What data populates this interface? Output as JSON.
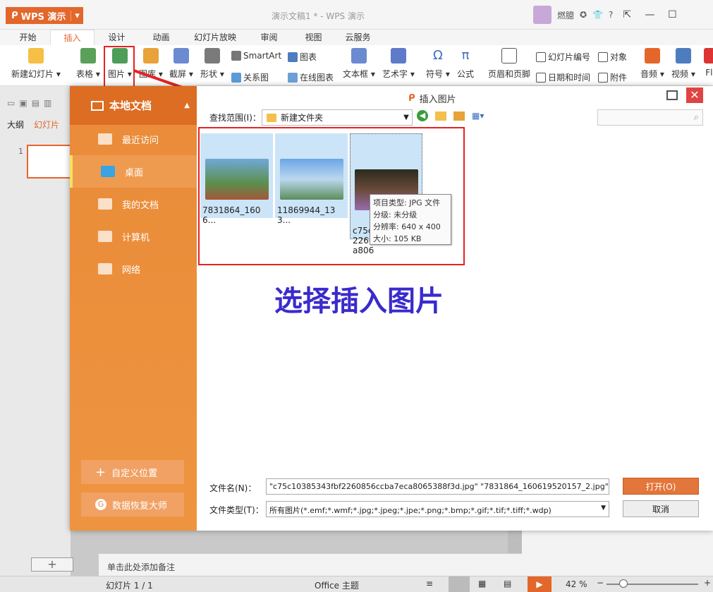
{
  "app": {
    "name": "WPS 演示",
    "doc_title": "演示文稿1 * - WPS 演示",
    "user": "燃臆"
  },
  "tabs": [
    "开始",
    "插入",
    "设计",
    "动画",
    "幻灯片放映",
    "审阅",
    "视图",
    "云服务"
  ],
  "active_tab": "插入",
  "ribbon": {
    "new_slide": "新建幻灯片",
    "table": "表格",
    "picture": "图片",
    "gallery": "图库",
    "screenshot": "截屏",
    "shape": "形状",
    "smartart": "SmartArt",
    "relation": "关系图",
    "chart": "图表",
    "online_chart": "在线图表",
    "textbox": "文本框",
    "wordart": "艺术字",
    "symbol": "符号",
    "formula": "公式",
    "header_footer": "页眉和页脚",
    "slide_number": "幻灯片编号",
    "date_time": "日期和时间",
    "object": "对象",
    "attachment": "附件",
    "audio": "音频",
    "video": "视频",
    "flash": "Fla"
  },
  "left_panel": {
    "outline": "大纲",
    "slides": "幻灯片",
    "slide_number": "1"
  },
  "dialog": {
    "title": "插入图片",
    "side_title": "本地文档",
    "side_items": [
      "最近访问",
      "桌面",
      "我的文档",
      "计算机",
      "网络"
    ],
    "active_side": "桌面",
    "custom_location": "自定义位置",
    "recovery": "数据恢复大师",
    "look_in_label": "查找范围(I)：",
    "look_in_value": "新建文件夹",
    "files": [
      {
        "name": "7831864_1606...",
        "color": "#6fa36b"
      },
      {
        "name": "11869944_133...",
        "color": "#7ea9d8"
      },
      {
        "name": "c75c\n2260\na806",
        "color": "#6a4a3a"
      }
    ],
    "tooltip": {
      "type": "项目类型: JPG 文件",
      "rating": "分级: 未分级",
      "resolution": "分辨率: 640 x 400",
      "size": "大小: 105 KB"
    },
    "annotation": "选择插入图片",
    "filename_label": "文件名(N)：",
    "filename_value": "\"c75c10385343fbf2260856ccba7eca8065388f3d.jpg\" \"7831864_160619520157_2.jpg\" \"",
    "filetype_label": "文件类型(T)：",
    "filetype_value": "所有图片(*.emf;*.wmf;*.jpg;*.jpeg;*.jpe;*.png;*.bmp;*.gif;*.tif;*.tiff;*.wdp)",
    "open": "打开(O)",
    "cancel": "取消"
  },
  "notes": "单击此处添加备注",
  "status": {
    "slide": "幻灯片 1 / 1",
    "theme": "Office 主题",
    "zoom": "42 %"
  }
}
